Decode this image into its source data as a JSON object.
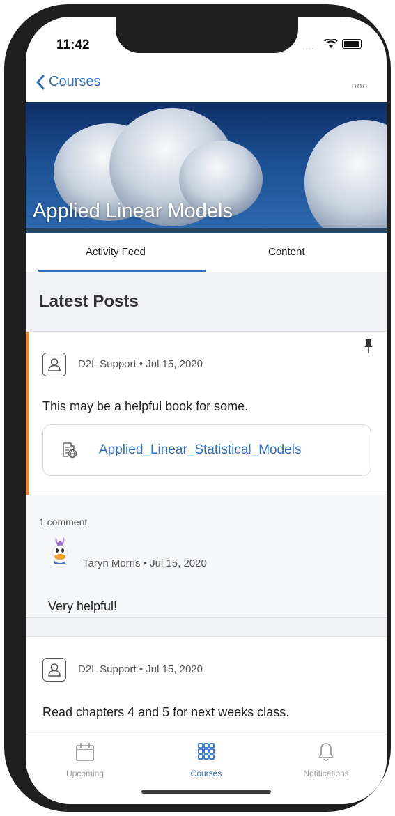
{
  "status": {
    "time": "11:42",
    "signal": "....",
    "wifi_icon": "wifi-icon",
    "battery_icon": "battery-icon"
  },
  "nav": {
    "back_label": "Courses",
    "more_label": "ooo"
  },
  "course": {
    "title": "Applied Linear Models"
  },
  "tabs": [
    {
      "label": "Activity Feed",
      "active": true
    },
    {
      "label": "Content",
      "active": false
    }
  ],
  "section": {
    "title": "Latest Posts"
  },
  "posts": [
    {
      "author": "D2L Support",
      "date": "Jul 15, 2020",
      "meta": "D2L Support • Jul 15, 2020",
      "body": "This may be a helpful book for some.",
      "pinned": true,
      "attachment": {
        "name": "Applied_Linear_Statistical_Models",
        "icon": "web-document-icon"
      },
      "comment_count": "1 comment",
      "comments": [
        {
          "author": "Taryn Morris",
          "date": "Jul 15, 2020",
          "meta": "Taryn Morris • Jul 15, 2020",
          "body": "Very helpful!"
        }
      ]
    },
    {
      "author": "D2L Support",
      "date": "Jul 15, 2020",
      "meta": "D2L Support • Jul 15, 2020",
      "body": "Read chapters 4 and 5 for next weeks class."
    }
  ],
  "tabbar": [
    {
      "label": "Upcoming",
      "icon": "calendar-icon",
      "active": false
    },
    {
      "label": "Courses",
      "icon": "grid-icon",
      "active": true
    },
    {
      "label": "Notifications",
      "icon": "bell-icon",
      "active": false
    }
  ],
  "colors": {
    "accent": "#2e6fc7",
    "post_accent": "#e0883a",
    "header_bg": "#f1f2f6"
  }
}
